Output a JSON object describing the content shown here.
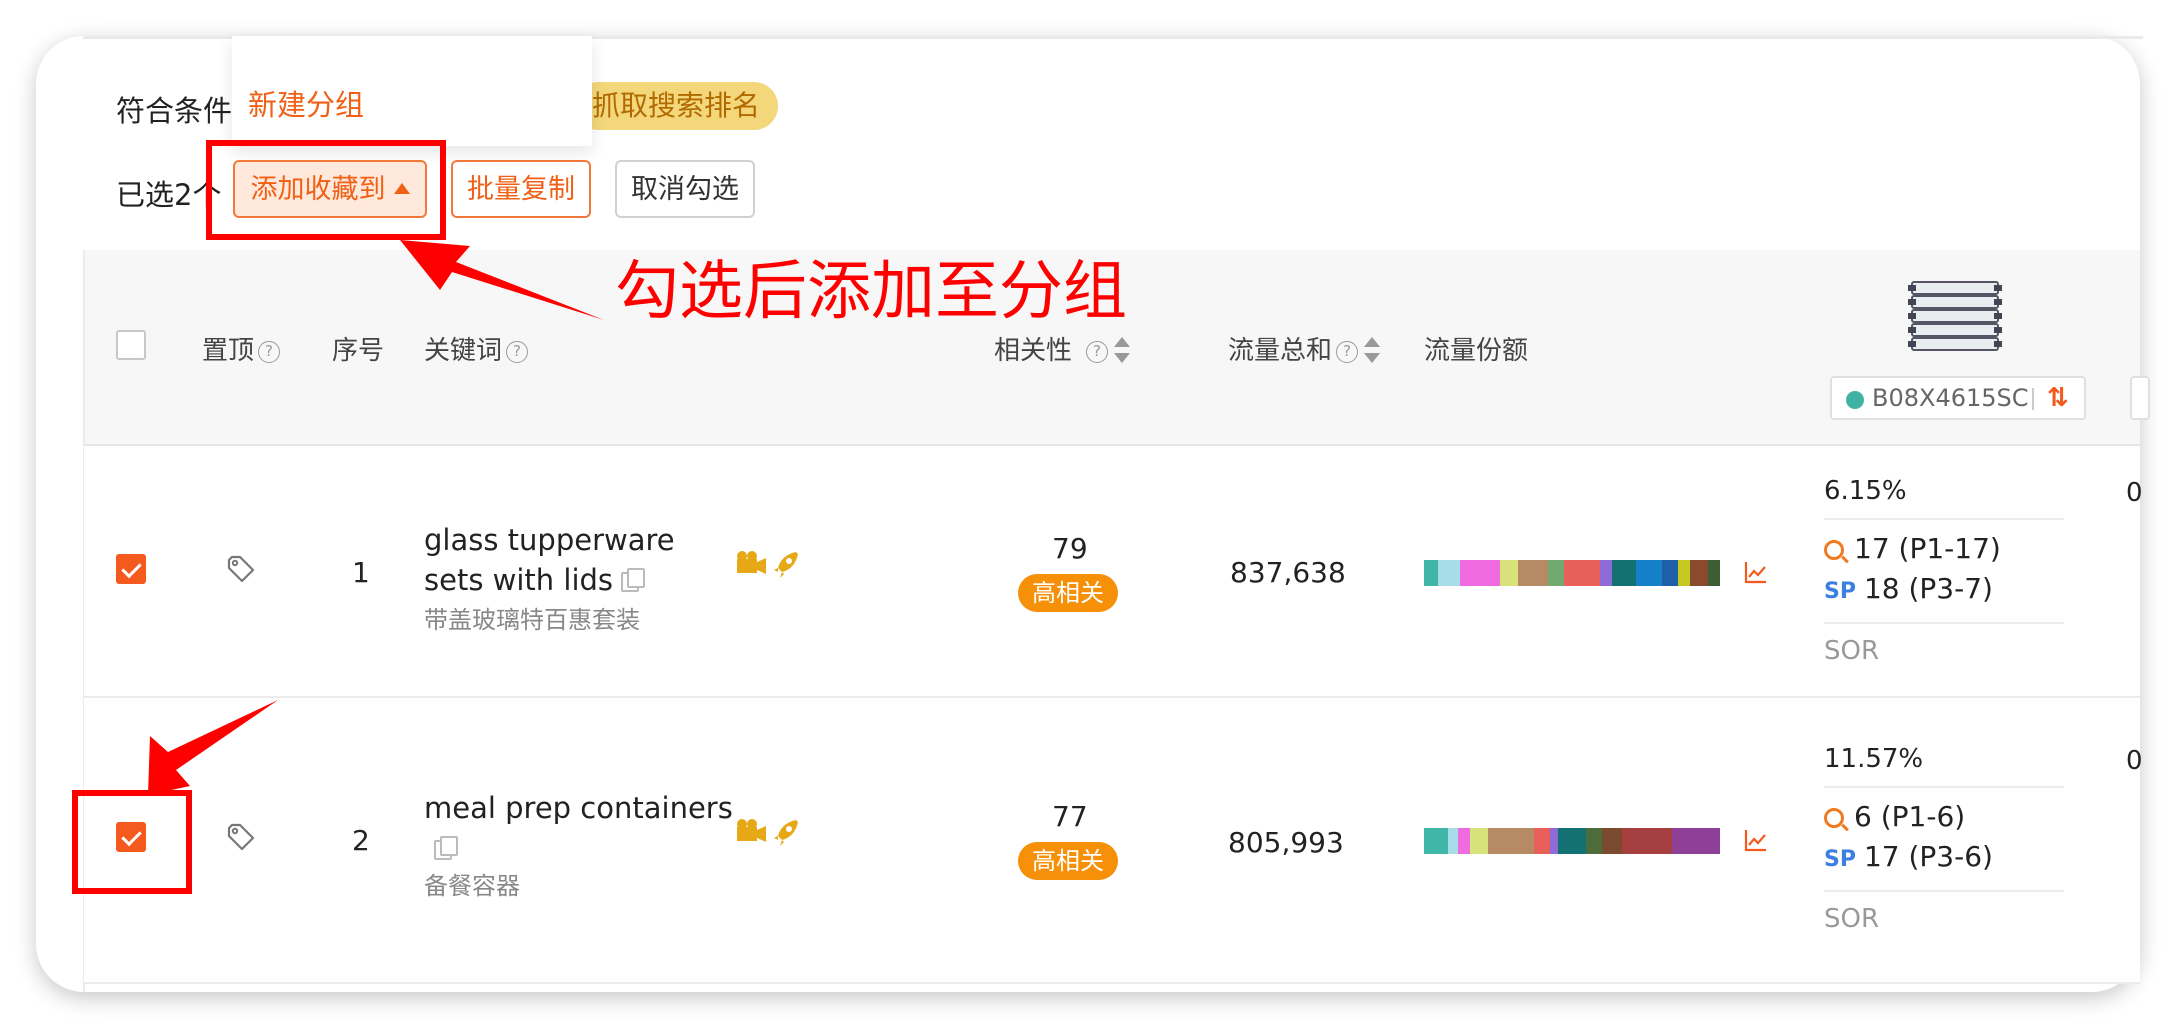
{
  "toolbar": {
    "match_text": "符合条件的",
    "grab_rank_label": "抓取搜索排名",
    "dropdown_new_group": "新建分组",
    "selected_count": "已选2个",
    "add_to_favorites": "添加收藏到",
    "batch_copy": "批量复制",
    "cancel_select": "取消勾选"
  },
  "annotation": {
    "text": "勾选后添加至分组",
    "color": "#ff0000"
  },
  "table": {
    "headers": {
      "pin": "置顶",
      "index": "序号",
      "keyword": "关键词",
      "relevance": "相关性",
      "traffic_total": "流量总和",
      "traffic_share": "流量份额"
    },
    "asin": "B08X4615SC",
    "rows": [
      {
        "checked": true,
        "index": "1",
        "keyword_line1": "glass tupperware",
        "keyword_line2": "sets with lids",
        "keyword_cn": "带盖玻璃特百惠套装",
        "relevance": "79",
        "relevance_tag": "高相关",
        "traffic_total": "837,638",
        "share_pct": "6.15%",
        "natural_rank": "17 (P1-17)",
        "sp_label": "SP",
        "sp_rank": "18 (P3-7)",
        "sor": "SOR",
        "next_col_fragment": "0"
      },
      {
        "checked": true,
        "index": "2",
        "keyword_line1": "meal prep containers",
        "keyword_line2": "",
        "keyword_cn": "备餐容器",
        "relevance": "77",
        "relevance_tag": "高相关",
        "traffic_total": "805,993",
        "share_pct": "11.57%",
        "natural_rank": "6 (P1-6)",
        "sp_label": "SP",
        "sp_rank": "17 (P3-6)",
        "sor": "SOR",
        "next_col_fragment": "0"
      }
    ]
  },
  "colors": {
    "accent": "#f45a1d",
    "tag_orange": "#f79009",
    "sp_blue": "#3b7fe0",
    "asin_dot": "#41b3a3"
  },
  "icons": [
    "help-icon",
    "sort-icon",
    "tag-icon",
    "copy-icon",
    "video-icon",
    "rocket-icon",
    "trend-chart-icon",
    "search-icon",
    "swap-icon"
  ]
}
